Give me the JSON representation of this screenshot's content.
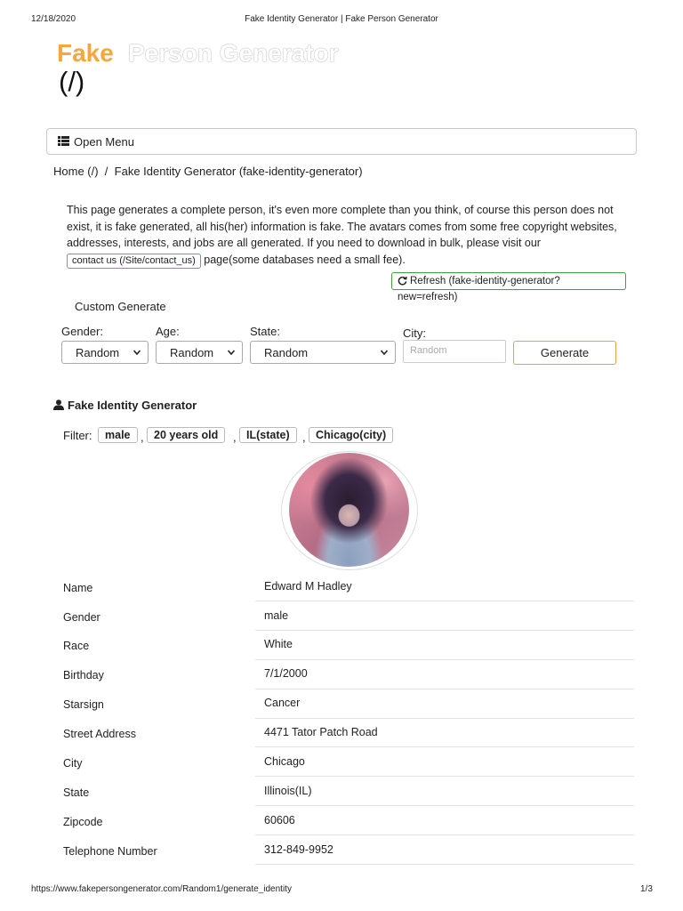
{
  "print_header": {
    "date": "12/18/2020",
    "title": "Fake Identity Generator | Fake Person Generator"
  },
  "logo": {
    "fake": "Fake",
    "rest": "Person Generator",
    "path": "(/)"
  },
  "menu": {
    "label": "Open Menu",
    "icon": "list-icon"
  },
  "breadcrumb": {
    "home": "Home (/)",
    "sep": "/",
    "current": "Fake Identity Generator (fake-identity-generator)"
  },
  "intro": {
    "text_before": "This page generates a complete person, it's even more complete than you think, of course this person does not exist, it is fake generated, all his(her) information is fake. The avatars comes from some free copyright websites, addresses, interests, and jobs are all generated. If you need to download in bulk, please visit our ",
    "contact_button": "contact us (/Site/contact_us)",
    "text_after": " page(some databases need a small fee)."
  },
  "refresh_button": "Refresh (fake-identity-generator?new=refresh)",
  "custom_generate": {
    "title": "Custom Generate",
    "gender_label": "Gender:",
    "gender_value": "Random",
    "age_label": "Age:",
    "age_value": "Random",
    "state_label": "State:",
    "state_value": "Random",
    "city_label": "City:",
    "city_placeholder": "Random",
    "generate_button": "Generate"
  },
  "section_title": "Fake Identity Generator",
  "filter": {
    "label": "Filter:",
    "chips": [
      "male",
      "20 years old",
      "IL(state)",
      "Chicago(city)"
    ],
    "separator": ","
  },
  "identity": [
    {
      "label": "Name",
      "value": "Edward M Hadley"
    },
    {
      "label": "Gender",
      "value": "male"
    },
    {
      "label": "Race",
      "value": "White"
    },
    {
      "label": "Birthday",
      "value": "7/1/2000"
    },
    {
      "label": "Starsign",
      "value": "Cancer"
    },
    {
      "label": "Street Address",
      "value": "4471 Tator Patch Road"
    },
    {
      "label": "City",
      "value": "Chicago"
    },
    {
      "label": "State",
      "value": "Illinois(IL)"
    },
    {
      "label": "Zipcode",
      "value": "60606"
    },
    {
      "label": "Telephone Number",
      "value": "312-849-9952"
    }
  ],
  "print_footer": {
    "url": "https://www.fakepersongenerator.com/Random1/generate_identity",
    "page": "1/3"
  },
  "colors": {
    "logo_accent": "#f4a73b",
    "refresh_border": "#3ca33c",
    "generate_border": "#e8a040",
    "contact_border": "#4aa3df"
  }
}
